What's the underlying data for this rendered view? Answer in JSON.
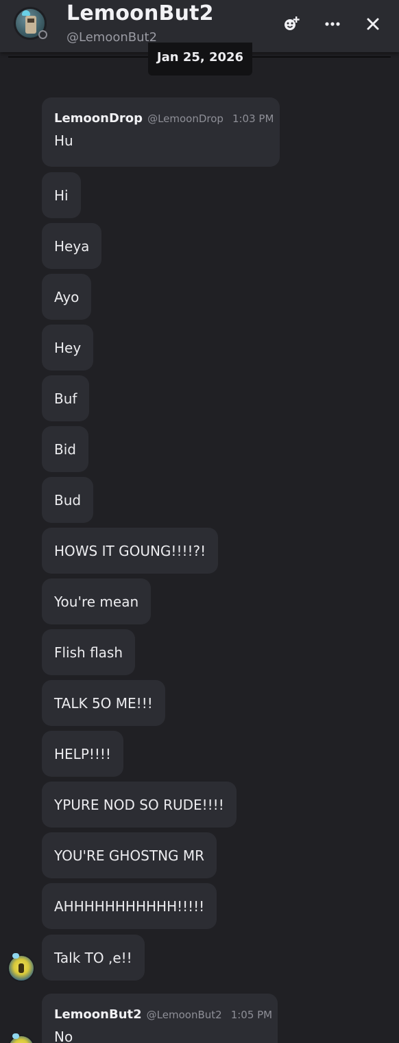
{
  "header": {
    "name": "LemoonBut2",
    "handle": "@LemoonBut2",
    "status": "offline"
  },
  "divider": {
    "date": "Jan 25, 2026"
  },
  "groups": [
    {
      "author": "LemoonDrop",
      "handle": "@LemoonDrop",
      "time": "1:03 PM",
      "first_text": "Hu",
      "messages": [
        "Hi",
        "Heya",
        "Ayo",
        "Hey",
        "Buf",
        "Bid",
        "Bud",
        "HOWS IT GOUNG!!!!?!",
        "You're mean",
        "Flish flash",
        "TALK 5O ME!!!",
        "HELP!!!!",
        "YPURE NOD SO RUDE!!!!",
        "YOU'RE GHOSTNG MR",
        "AHHHHHHHHHHH!!!!!",
        "Talk TO ,e!!"
      ]
    },
    {
      "author": "LemoonBut2",
      "handle": "@LemoonBut2",
      "time": "1:05 PM",
      "first_text": "No"
    }
  ],
  "icons": {
    "add_friend": "add-friend-icon",
    "more": "more-options-icon",
    "close": "close-icon"
  },
  "colors": {
    "background": "#202024",
    "header": "#2a2b30",
    "bubble": "#2c2d33",
    "date_pill": "#121214",
    "muted_text": "#8e8f97"
  }
}
